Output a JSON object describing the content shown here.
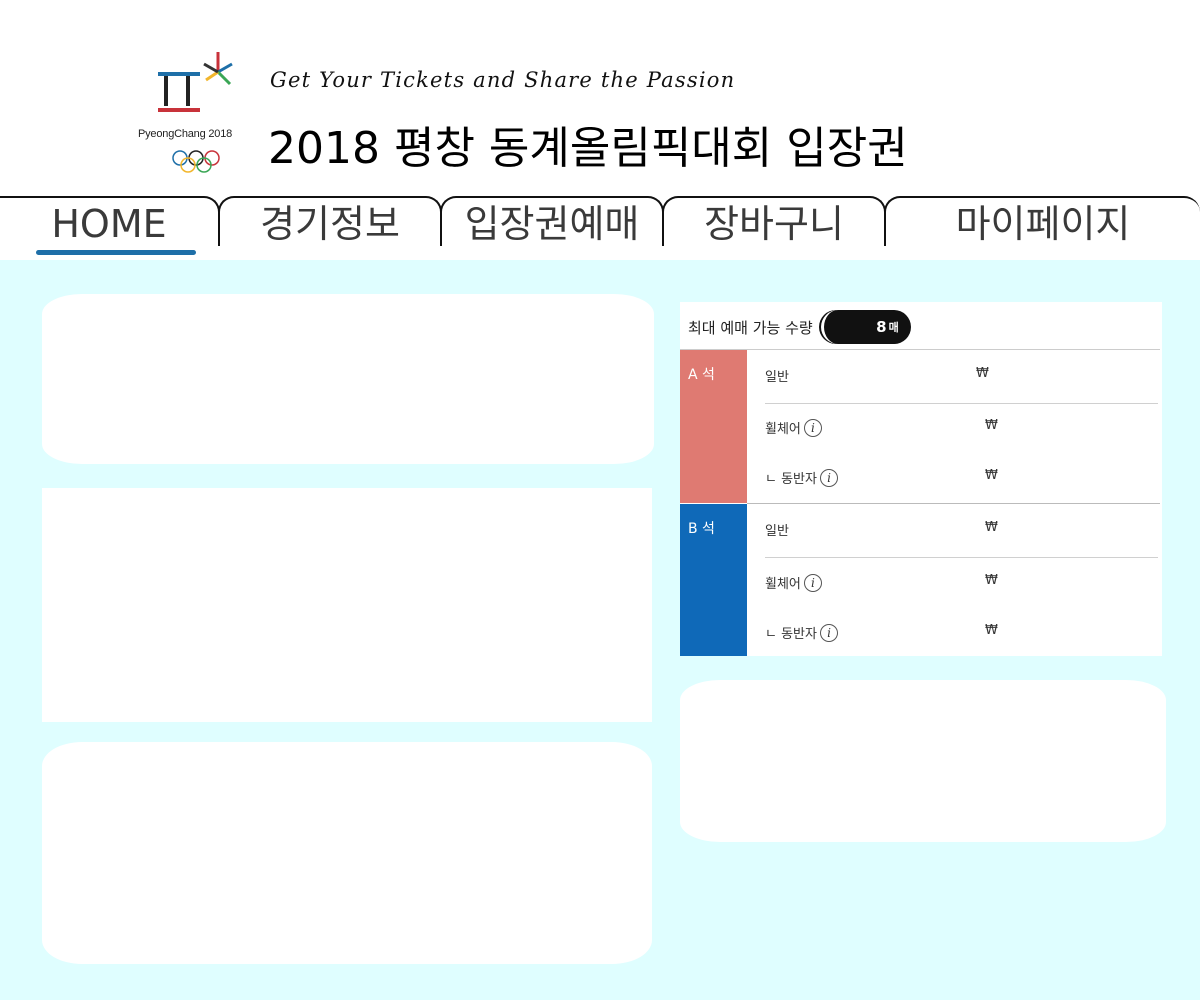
{
  "header": {
    "logo_text": "PyeongChang 2018",
    "tagline": "Get Your Tickets and Share the Passion",
    "title": "2018 평창 동계올림픽대회 입장권"
  },
  "nav": {
    "tabs": [
      {
        "label": "HOME",
        "active": true
      },
      {
        "label": "경기정보"
      },
      {
        "label": "입장권예매"
      },
      {
        "label": "장바구니"
      },
      {
        "label": "마이페이지"
      }
    ]
  },
  "seat_table": {
    "max_label": "최대 예매 가능 수량",
    "max_value": "8",
    "max_unit": "매",
    "sections": [
      {
        "name": "A 석",
        "color": "#df7a72",
        "rows": [
          {
            "kind": "일반",
            "info": false,
            "price": "₩"
          },
          {
            "kind": "휠체어",
            "info": true,
            "price": "₩"
          },
          {
            "kind": "ㄴ 동반자",
            "info": true,
            "price": "₩"
          }
        ]
      },
      {
        "name": "B 석",
        "color": "#0f69b8",
        "rows": [
          {
            "kind": "일반",
            "info": false,
            "price": "₩"
          },
          {
            "kind": "휠체어",
            "info": true,
            "price": "₩"
          },
          {
            "kind": "ㄴ 동반자",
            "info": true,
            "price": "₩"
          }
        ]
      }
    ]
  },
  "colors": {
    "content_bg": "#dffeff",
    "accent_underline": "#1e6fa8"
  }
}
